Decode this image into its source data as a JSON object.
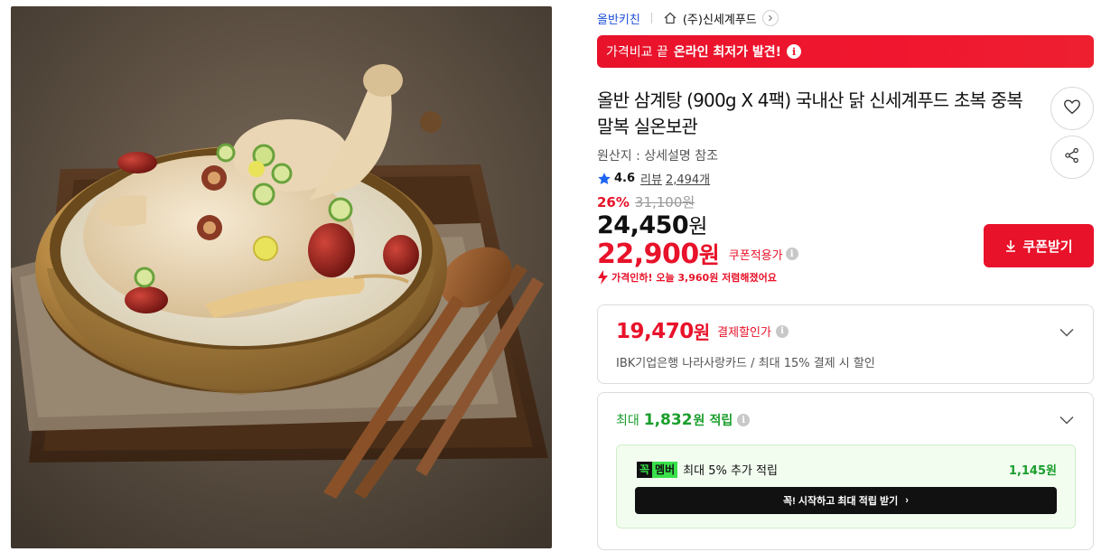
{
  "breadcrumb": {
    "brand": "올반키친",
    "seller": "(주)신세계푸드"
  },
  "promo": {
    "prefix": "가격비교 끝",
    "highlight": "온라인 최저가 발견!",
    "info_glyph": "i"
  },
  "product": {
    "title": "올반 삼계탕 (900g X 4팩) 국내산 닭 신세계푸드 초복 중복 말복 실온보관",
    "origin": "원산지 : 상세설명 참조",
    "rating": "4.6",
    "review_label": "리뷰",
    "review_count": "2,494개"
  },
  "pricing": {
    "discount_rate": "26%",
    "original_price": "31,100원",
    "sale_price": "24,450",
    "sale_unit": "원",
    "coupon_price": "22,900",
    "coupon_unit": "원",
    "coupon_label": "쿠폰적용가",
    "drop_notice": "가격인하! 오늘 3,960원 저렴해졌어요",
    "coupon_button": "쿠폰받기"
  },
  "payment_card": {
    "amount": "19,470",
    "unit": "원",
    "label": "결제할인가",
    "description": "IBK기업은행 나라사랑카드 / 최대 15% 결제 시 할인"
  },
  "points_card": {
    "prefix": "최대",
    "amount": "1,832",
    "unit": "원",
    "suffix": "적립",
    "member_badge_left": "꼭",
    "member_badge_right": "멤버",
    "member_text": "최대 5% 추가 적립",
    "member_amount": "1,145원",
    "cta_label": "꼭! 시작하고 최대 적립 받기",
    "cta_arrow": "›"
  },
  "colors": {
    "accent_red": "#e8122a",
    "brand_blue": "#1d4fd8",
    "points_green": "#1a9e2c",
    "member_green": "#39e14b"
  },
  "icons": [
    "home-icon",
    "chevron-right-icon",
    "info-icon",
    "heart-icon",
    "share-icon",
    "star-icon",
    "price-drop-icon",
    "download-icon",
    "chevron-down-icon"
  ]
}
